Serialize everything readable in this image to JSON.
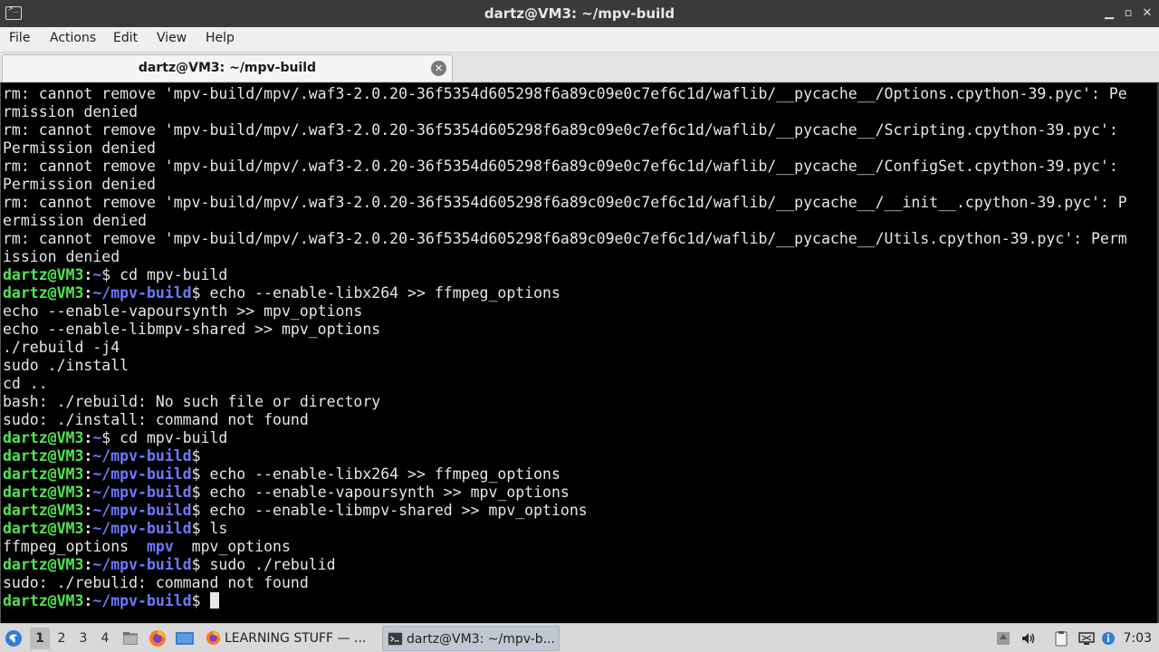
{
  "window": {
    "title": "dartz@VM3: ~/mpv-build",
    "minimize_glyph": "▁",
    "maximize_glyph": "▫",
    "close_glyph": "✕"
  },
  "menu": [
    "File",
    "Actions",
    "Edit",
    "View",
    "Help"
  ],
  "tab": {
    "label": "dartz@VM3: ~/mpv-build",
    "close_glyph": "✕"
  },
  "terminal": {
    "prompt_user": "dartz@VM3",
    "lines": [
      {
        "type": "out",
        "text": "rm: cannot remove 'mpv-build/mpv/.waf3-2.0.20-36f5354d605298f6a89c09e0c7ef6c1d/waflib/__pycache__/Options.cpython-39.pyc': Pe"
      },
      {
        "type": "out",
        "text": "rmission denied"
      },
      {
        "type": "out",
        "text": "rm: cannot remove 'mpv-build/mpv/.waf3-2.0.20-36f5354d605298f6a89c09e0c7ef6c1d/waflib/__pycache__/Scripting.cpython-39.pyc':"
      },
      {
        "type": "out",
        "text": "Permission denied"
      },
      {
        "type": "out",
        "text": "rm: cannot remove 'mpv-build/mpv/.waf3-2.0.20-36f5354d605298f6a89c09e0c7ef6c1d/waflib/__pycache__/ConfigSet.cpython-39.pyc':"
      },
      {
        "type": "out",
        "text": "Permission denied"
      },
      {
        "type": "out",
        "text": "rm: cannot remove 'mpv-build/mpv/.waf3-2.0.20-36f5354d605298f6a89c09e0c7ef6c1d/waflib/__pycache__/__init__.cpython-39.pyc': P"
      },
      {
        "type": "out",
        "text": "ermission denied"
      },
      {
        "type": "out",
        "text": "rm: cannot remove 'mpv-build/mpv/.waf3-2.0.20-36f5354d605298f6a89c09e0c7ef6c1d/waflib/__pycache__/Utils.cpython-39.pyc': Perm"
      },
      {
        "type": "out",
        "text": "ission denied"
      },
      {
        "type": "prompt",
        "path": "~",
        "cmd": "cd mpv-build"
      },
      {
        "type": "prompt",
        "path": "~/mpv-build",
        "cmd": "echo --enable-libx264 >> ffmpeg_options"
      },
      {
        "type": "out",
        "text": "echo --enable-vapoursynth >> mpv_options"
      },
      {
        "type": "out",
        "text": "echo --enable-libmpv-shared >> mpv_options"
      },
      {
        "type": "out",
        "text": "./rebuild -j4"
      },
      {
        "type": "out",
        "text": "sudo ./install"
      },
      {
        "type": "out",
        "text": "cd .."
      },
      {
        "type": "out",
        "text": "bash: ./rebuild: No such file or directory"
      },
      {
        "type": "out",
        "text": "sudo: ./install: command not found"
      },
      {
        "type": "prompt",
        "path": "~",
        "cmd": "cd mpv-build"
      },
      {
        "type": "prompt",
        "path": "~/mpv-build",
        "cmd": ""
      },
      {
        "type": "prompt",
        "path": "~/mpv-build",
        "cmd": "echo --enable-libx264 >> ffmpeg_options"
      },
      {
        "type": "prompt",
        "path": "~/mpv-build",
        "cmd": "echo --enable-vapoursynth >> mpv_options"
      },
      {
        "type": "prompt",
        "path": "~/mpv-build",
        "cmd": "echo --enable-libmpv-shared >> mpv_options"
      },
      {
        "type": "prompt",
        "path": "~/mpv-build",
        "cmd": "ls"
      },
      {
        "type": "ls",
        "items": [
          {
            "name": "ffmpeg_options",
            "kind": "file"
          },
          {
            "name": "mpv",
            "kind": "dir"
          },
          {
            "name": "mpv_options",
            "kind": "file"
          }
        ]
      },
      {
        "type": "prompt",
        "path": "~/mpv-build",
        "cmd": "sudo ./rebulid"
      },
      {
        "type": "out",
        "text": "sudo: ./rebulid: command not found"
      },
      {
        "type": "prompt",
        "path": "~/mpv-build",
        "cmd": "",
        "cursor": true
      }
    ]
  },
  "taskbar": {
    "workspaces": [
      "1",
      "2",
      "3",
      "4"
    ],
    "active_workspace": "1",
    "tasks": [
      {
        "label": "LEARNING STUFF — ...",
        "icon": "firefox-icon",
        "active": false
      },
      {
        "label": "dartz@VM3: ~/mpv-b...",
        "icon": "terminal-icon",
        "active": true
      }
    ],
    "clock": "7:03"
  },
  "colors": {
    "prompt_user": "#4fe64f",
    "prompt_path": "#6f78ff",
    "terminal_bg": "#000000",
    "terminal_fg": "#e6e6e6"
  }
}
